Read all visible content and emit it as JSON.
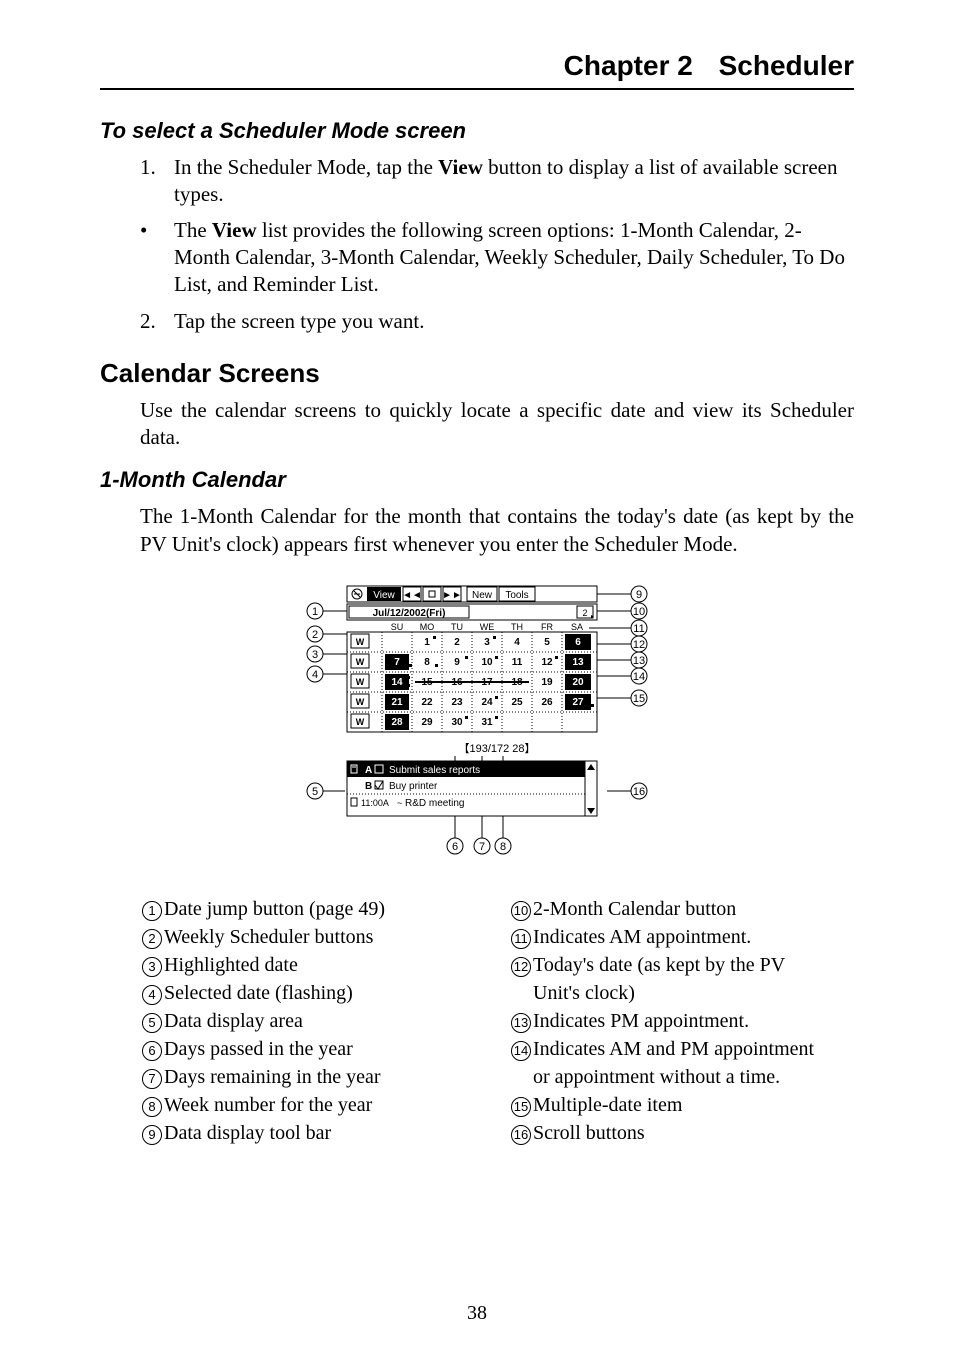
{
  "header": {
    "chapter": "Chapter 2",
    "title": "Scheduler"
  },
  "sec1": {
    "heading": "To select a Scheduler Mode screen",
    "step1_num": "1.",
    "step1_a": "In the Scheduler Mode, tap the ",
    "step1_bold": "View",
    "step1_b": " button to display a list of available screen types.",
    "bullet_mark": "•",
    "bullet_a": "The ",
    "bullet_bold": "View",
    "bullet_b": " list provides the following screen options: 1-Month Calendar, 2-Month Calendar, 3-Month Calendar, Weekly Scheduler, Daily Scheduler, To Do List, and Reminder List.",
    "step2_num": "2.",
    "step2": "Tap the screen type you want."
  },
  "sec2": {
    "heading": "Calendar Screens",
    "para": "Use the calendar screens to quickly locate a specific date and view its Scheduler data."
  },
  "sec3": {
    "heading": "1-Month Calendar",
    "para": "The 1-Month Calendar for the month that contains the today's date (as kept by the PV Unit's clock) appears first whenever you enter the Scheduler Mode."
  },
  "figure": {
    "toolbar": {
      "view": "View",
      "new": "New",
      "tools": "Tools"
    },
    "date_title": "Jul/12/2002(Fri)",
    "two_month_btn": "2",
    "days": [
      "SU",
      "MO",
      "TU",
      "WE",
      "TH",
      "FR",
      "SA"
    ],
    "week_btn": "W",
    "grid": [
      [
        "",
        "1",
        "2",
        "3",
        "4",
        "5",
        "6"
      ],
      [
        "7",
        "8",
        "9",
        "10",
        "11",
        "12",
        "13"
      ],
      [
        "14",
        "15",
        "16",
        "17",
        "18",
        "19",
        "20"
      ],
      [
        "21",
        "22",
        "23",
        "24",
        "25",
        "26",
        "27"
      ],
      [
        "28",
        "29",
        "30",
        "31",
        "",
        "",
        ""
      ]
    ],
    "counters": "【193/172 28】",
    "data_rows": {
      "r1_tag": "A",
      "r1_text": "Submit sales reports",
      "r2_tag": "B",
      "r2_text": "Buy printer",
      "r3_tag": "11:00A",
      "r3_text": "R&D meeting"
    }
  },
  "legend_left": [
    {
      "n": "1",
      "t": "Date jump button (page 49)"
    },
    {
      "n": "2",
      "t": "Weekly Scheduler buttons"
    },
    {
      "n": "3",
      "t": "Highlighted date"
    },
    {
      "n": "4",
      "t": "Selected date (flashing)"
    },
    {
      "n": "5",
      "t": "Data display area"
    },
    {
      "n": "6",
      "t": "Days passed in the year"
    },
    {
      "n": "7",
      "t": "Days remaining in the year"
    },
    {
      "n": "8",
      "t": "Week number for the year"
    },
    {
      "n": "9",
      "t": "Data display tool bar"
    }
  ],
  "legend_right": [
    {
      "n": "10",
      "t": "2-Month Calendar button"
    },
    {
      "n": "11",
      "t": "Indicates AM appointment."
    },
    {
      "n": "12",
      "t": "Today's date (as kept by the PV",
      "cont": "Unit's clock)"
    },
    {
      "n": "13",
      "t": "Indicates PM appointment."
    },
    {
      "n": "14",
      "t": "Indicates AM and PM appointment",
      "cont": "or appointment without a time."
    },
    {
      "n": "15",
      "t": "Multiple-date item"
    },
    {
      "n": "16",
      "t": "Scroll buttons"
    }
  ],
  "page_number": "38"
}
